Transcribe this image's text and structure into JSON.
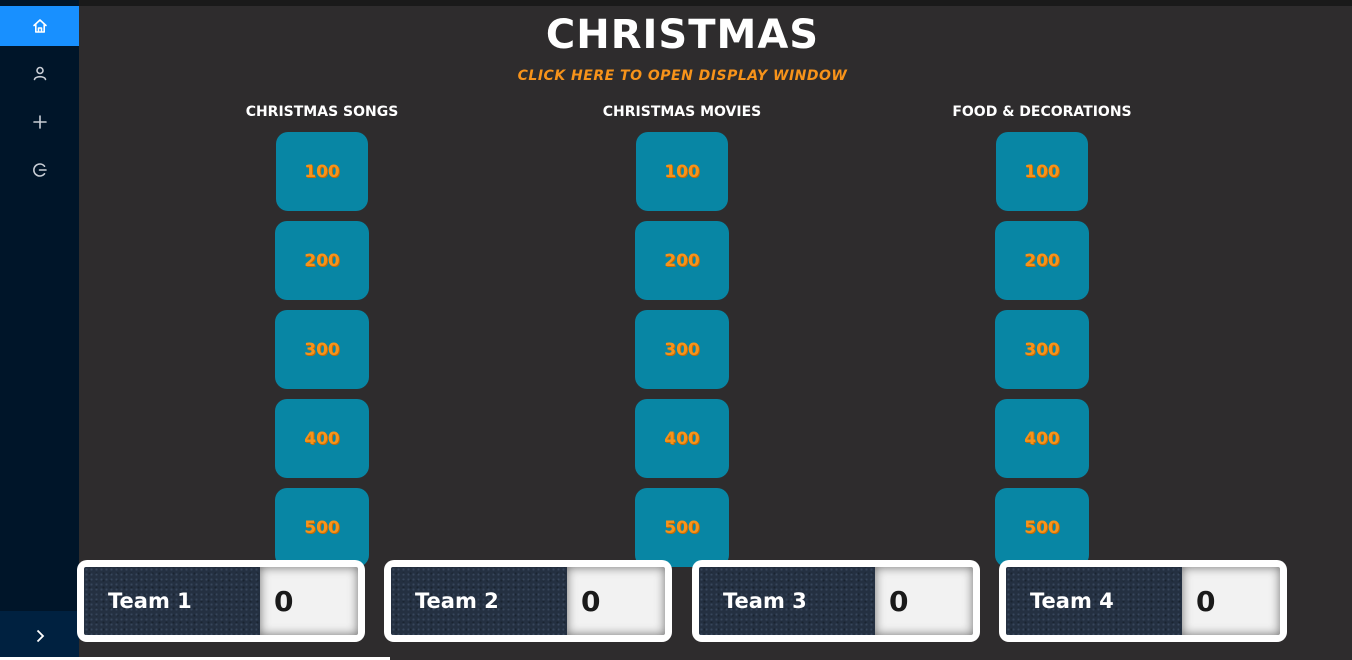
{
  "sidebar": {
    "items": [
      {
        "icon": "home-icon"
      },
      {
        "icon": "user-icon"
      },
      {
        "icon": "plus-icon"
      },
      {
        "icon": "logout-icon"
      }
    ],
    "collapse_icon": "chevron-right-icon"
  },
  "board": {
    "title": "CHRISTMAS",
    "display_link": "CLICK HERE TO OPEN DISPLAY WINDOW",
    "categories": [
      {
        "title": "CHRISTMAS SONGS",
        "values": [
          "100",
          "200",
          "300",
          "400",
          "500"
        ]
      },
      {
        "title": "CHRISTMAS MOVIES",
        "values": [
          "100",
          "200",
          "300",
          "400",
          "500"
        ]
      },
      {
        "title": "FOOD & DECORATIONS",
        "values": [
          "100",
          "200",
          "300",
          "400",
          "500"
        ]
      }
    ]
  },
  "teams": [
    {
      "name": "Team 1",
      "score": "0"
    },
    {
      "name": "Team 2",
      "score": "0"
    },
    {
      "name": "Team 3",
      "score": "0"
    },
    {
      "name": "Team 4",
      "score": "0"
    }
  ],
  "colors": {
    "background": "#2e2c2d",
    "sidebar": "#001529",
    "sidebar_active": "#1890ff",
    "tile": "#0886a4",
    "accent": "#f7931a"
  }
}
